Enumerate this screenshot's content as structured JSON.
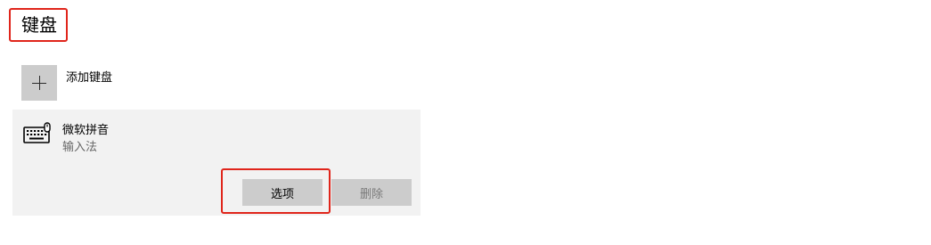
{
  "section": {
    "title": "键盘"
  },
  "add_keyboard": {
    "label": "添加键盘",
    "icon": "plus-icon"
  },
  "keyboard_item": {
    "name": "微软拼音",
    "type": "输入法",
    "icon": "keyboard-icon"
  },
  "buttons": {
    "options_label": "选项",
    "delete_label": "删除",
    "delete_enabled": false
  },
  "colors": {
    "highlight_border": "#e0251b",
    "card_background": "#f2f2f2",
    "button_background": "#cccccc"
  }
}
